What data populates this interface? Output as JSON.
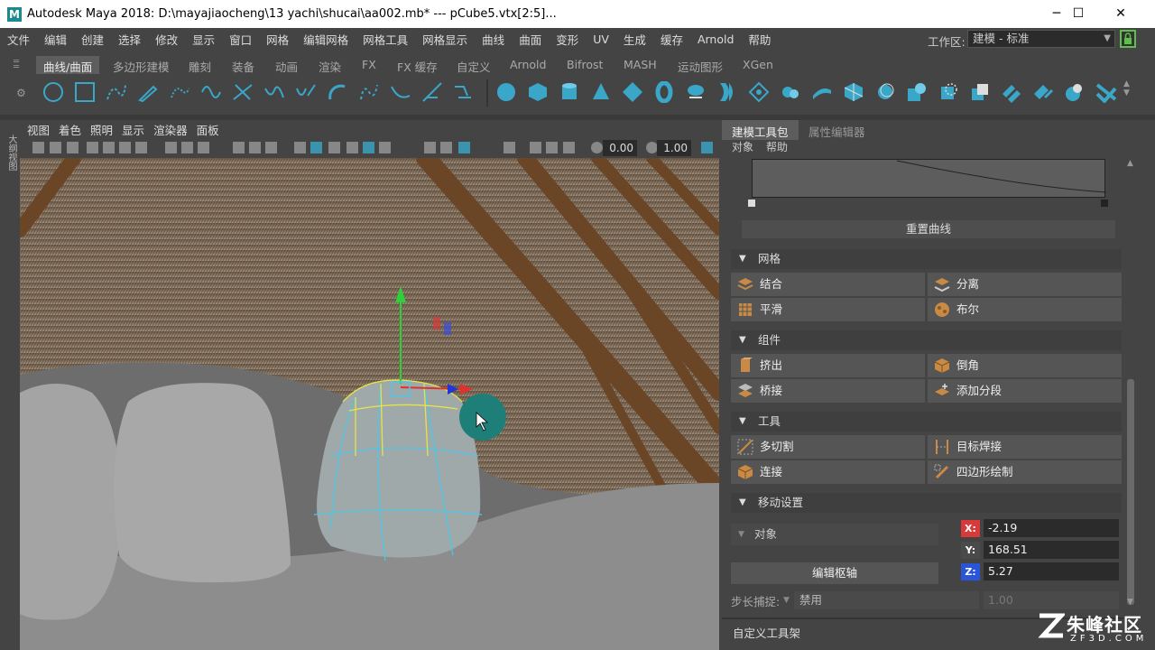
{
  "window": {
    "title": "Autodesk Maya 2018: D:\\mayajiaocheng\\13 yachi\\shucai\\aa002.mb*   ---   pCube5.vtx[2:5]...",
    "logo": "M",
    "minimize": "─",
    "maximize": "☐",
    "close": "✕"
  },
  "menubar": [
    "文件",
    "编辑",
    "创建",
    "选择",
    "修改",
    "显示",
    "窗口",
    "网格",
    "编辑网格",
    "网格工具",
    "网格显示",
    "曲线",
    "曲面",
    "变形",
    "UV",
    "生成",
    "缓存",
    "Arnold",
    "帮助"
  ],
  "workspace": {
    "label": "工作区:",
    "value": "建模 - 标准"
  },
  "shelf_tabs": [
    "曲线/曲面",
    "多边形建模",
    "雕刻",
    "装备",
    "动画",
    "渲染",
    "FX",
    "FX 缓存",
    "自定义",
    "Arnold",
    "Bifrost",
    "MASH",
    "运动图形",
    "XGen"
  ],
  "outliner_tab": "大纲视图",
  "viewport": {
    "menus": [
      "视图",
      "着色",
      "照明",
      "显示",
      "渲染器",
      "面板"
    ],
    "field_a": "0.00",
    "field_b": "1.00"
  },
  "right_panel": {
    "tabs": [
      "建模工具包",
      "属性编辑器"
    ],
    "menus": [
      "对象",
      "帮助"
    ],
    "reset_curve": "重置曲线",
    "sections": {
      "mesh": "网格",
      "components": "组件",
      "tools": "工具",
      "move": "移动设置"
    },
    "mesh_buttons": [
      "结合",
      "分离",
      "平滑",
      "布尔"
    ],
    "component_buttons": [
      "挤出",
      "倒角",
      "桥接",
      "添加分段"
    ],
    "tool_buttons": [
      "多切割",
      "目标焊接",
      "连接",
      "四边形绘制"
    ],
    "move": {
      "object_label": "对象",
      "edit_pivot": "编辑枢轴",
      "x_label": "X:",
      "x": "-2.19",
      "y_label": "Y:",
      "y": "168.51",
      "z_label": "Z:",
      "z": "5.27",
      "snap_label": "步长捕捉:",
      "snap_value": "禁用",
      "snap_step": "1.00"
    },
    "custom_shelf": "自定义工具架"
  },
  "watermark": {
    "brand": "朱峰社区",
    "url": "ZF3D.COM"
  },
  "colors": {
    "accent_green": "#5fbf4a",
    "tool_icon": "#c98a45",
    "shelf_icon_blue": "#3aa7c9"
  }
}
